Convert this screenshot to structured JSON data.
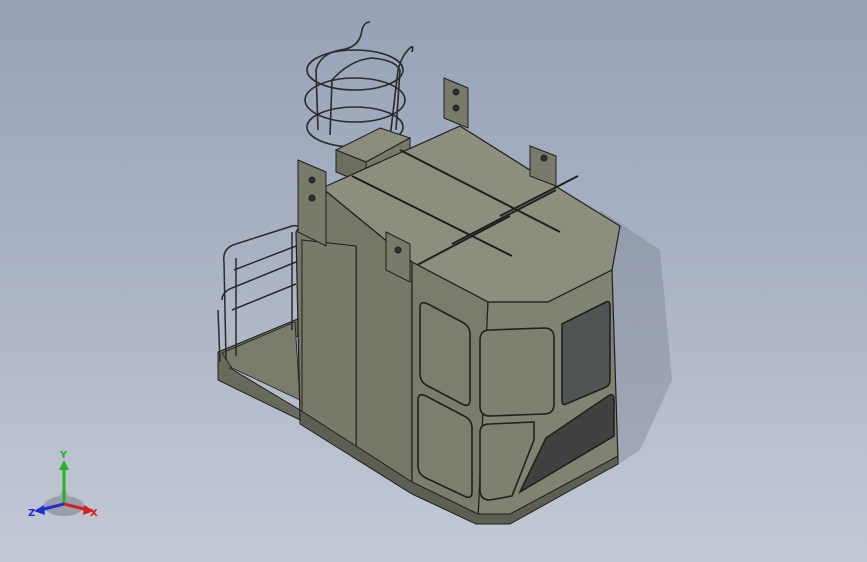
{
  "viewport": {
    "background_top": "#97a2b7",
    "background_bottom": "#c3c9d5"
  },
  "model": {
    "body_color": "#7c7c6c",
    "top_color": "#8e8e7e",
    "edge_color": "#202020",
    "window_color": "#4a4d4b"
  },
  "triad": {
    "x_label": "X",
    "y_label": "Y",
    "z_label": "Z",
    "x_color": "#d42020",
    "y_color": "#28b028",
    "z_color": "#2030d0"
  }
}
